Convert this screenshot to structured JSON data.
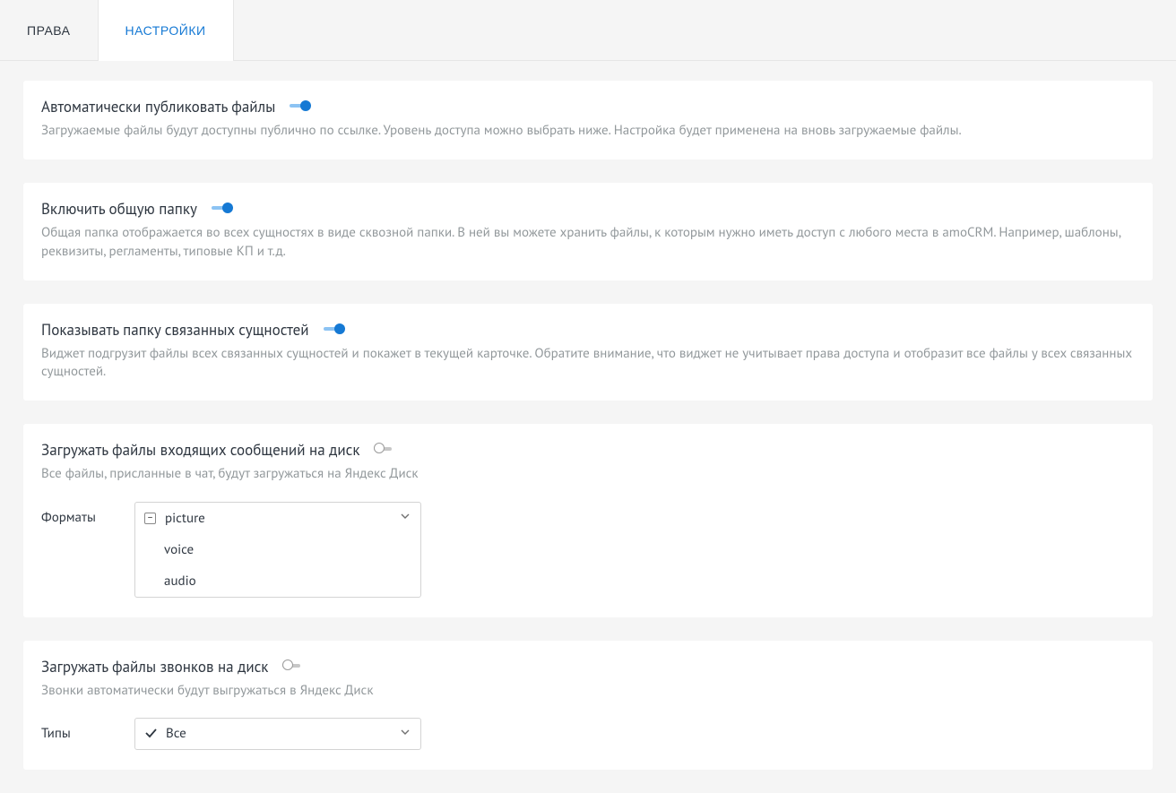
{
  "tabs": {
    "rights": "ПРАВА",
    "settings": "НАСТРОЙКИ"
  },
  "card_auto_publish": {
    "title": "Автоматически публиковать файлы",
    "desc": "Загружаемые файлы будут доступны публично по ссылке. Уровень доступа можно выбрать ниже. Настройка будет применена на вновь загружаемые файлы."
  },
  "card_shared_folder": {
    "title": "Включить общую папку",
    "desc": "Общая папка отображается во всех сущностях в виде сквозной папки. В ней вы можете хранить файлы, к которым нужно иметь доступ с любого места в amoCRM. Например, шаблоны, реквизиты, регламенты, типовые КП и т.д."
  },
  "card_related_folder": {
    "title": "Показывать папку связанных сущностей",
    "desc": "Виджет подгрузит файлы всех связанных сущностей и покажет в текущей карточке. Обратите внимание, что виджет не учитывает права доступа и отобразит все файлы у всех связанных сущностей."
  },
  "card_incoming_files": {
    "title": "Загружать файлы входящих сообщений на диск",
    "desc": "Все файлы, присланные в чат, будут загружаться на Яндекс Диск",
    "field_label": "Форматы",
    "options": {
      "0": "picture",
      "1": "voice",
      "2": "audio"
    }
  },
  "card_call_files": {
    "title": "Загружать файлы звонков на диск",
    "desc": "Звонки автоматически будут выгружаться в Яндекс Диск",
    "field_label": "Типы",
    "selected": "Все"
  }
}
